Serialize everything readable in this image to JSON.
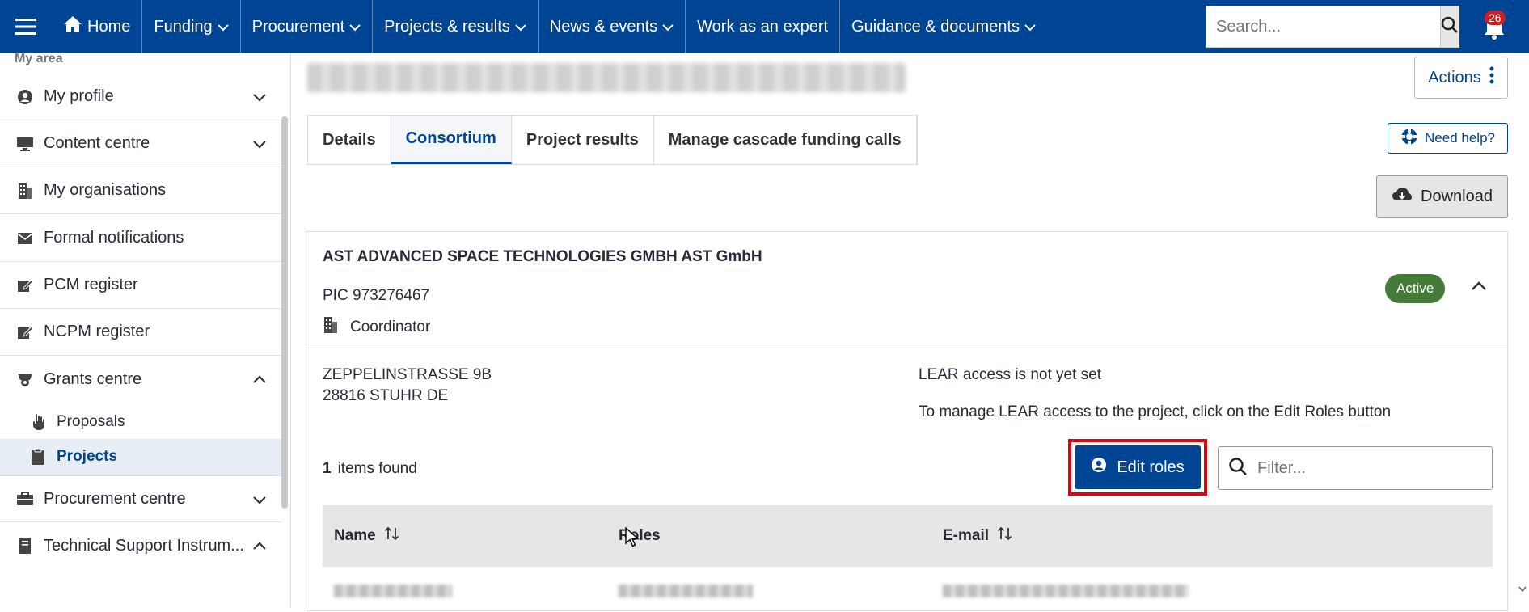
{
  "nav": {
    "home": "Home",
    "items": [
      "Funding",
      "Procurement",
      "Projects & results",
      "News & events",
      "Work as an expert",
      "Guidance & documents"
    ],
    "search_placeholder": "Search...",
    "notifications_count": "26"
  },
  "sidebar": {
    "section": "My area",
    "items": [
      {
        "label": "My profile",
        "icon": "user-circle-icon"
      },
      {
        "label": "Content centre",
        "icon": "monitor-icon"
      },
      {
        "label": "My organisations",
        "icon": "building-icon"
      },
      {
        "label": "Formal notifications",
        "icon": "mail-icon"
      },
      {
        "label": "PCM register",
        "icon": "edit-icon"
      },
      {
        "label": "NCPM register",
        "icon": "edit-icon"
      },
      {
        "label": "Grants centre",
        "icon": "award-icon"
      },
      {
        "label": "Proposals",
        "icon": "hand-icon"
      },
      {
        "label": "Projects",
        "icon": "clipboard-icon"
      },
      {
        "label": "Procurement centre",
        "icon": "briefcase-icon"
      },
      {
        "label": "Technical Support Instrum...",
        "icon": "book-icon"
      }
    ]
  },
  "main": {
    "actions_label": "Actions",
    "tabs": [
      "Details",
      "Consortium",
      "Project results",
      "Manage cascade funding calls"
    ],
    "help_label": "Need help?",
    "download_label": "Download",
    "org": {
      "name": "AST ADVANCED SPACE TECHNOLOGIES GMBH AST GmbH",
      "pic": "PIC 973276467",
      "role": "Coordinator",
      "status": "Active",
      "address_line1": "ZEPPELINSTRASSE 9B",
      "address_line2": "28816 STUHR DE",
      "lear_status": "LEAR access is not yet set",
      "lear_hint": "To manage LEAR access to the project, click on the Edit Roles button"
    },
    "items_count": "1",
    "items_found": "items found",
    "edit_roles_label": "Edit roles",
    "filter_placeholder": "Filter...",
    "table": {
      "columns": [
        "Name",
        "Roles",
        "E-mail"
      ]
    }
  },
  "colors": {
    "brand": "#004494",
    "active_badge": "#467a39",
    "highlight": "#e3000f"
  }
}
